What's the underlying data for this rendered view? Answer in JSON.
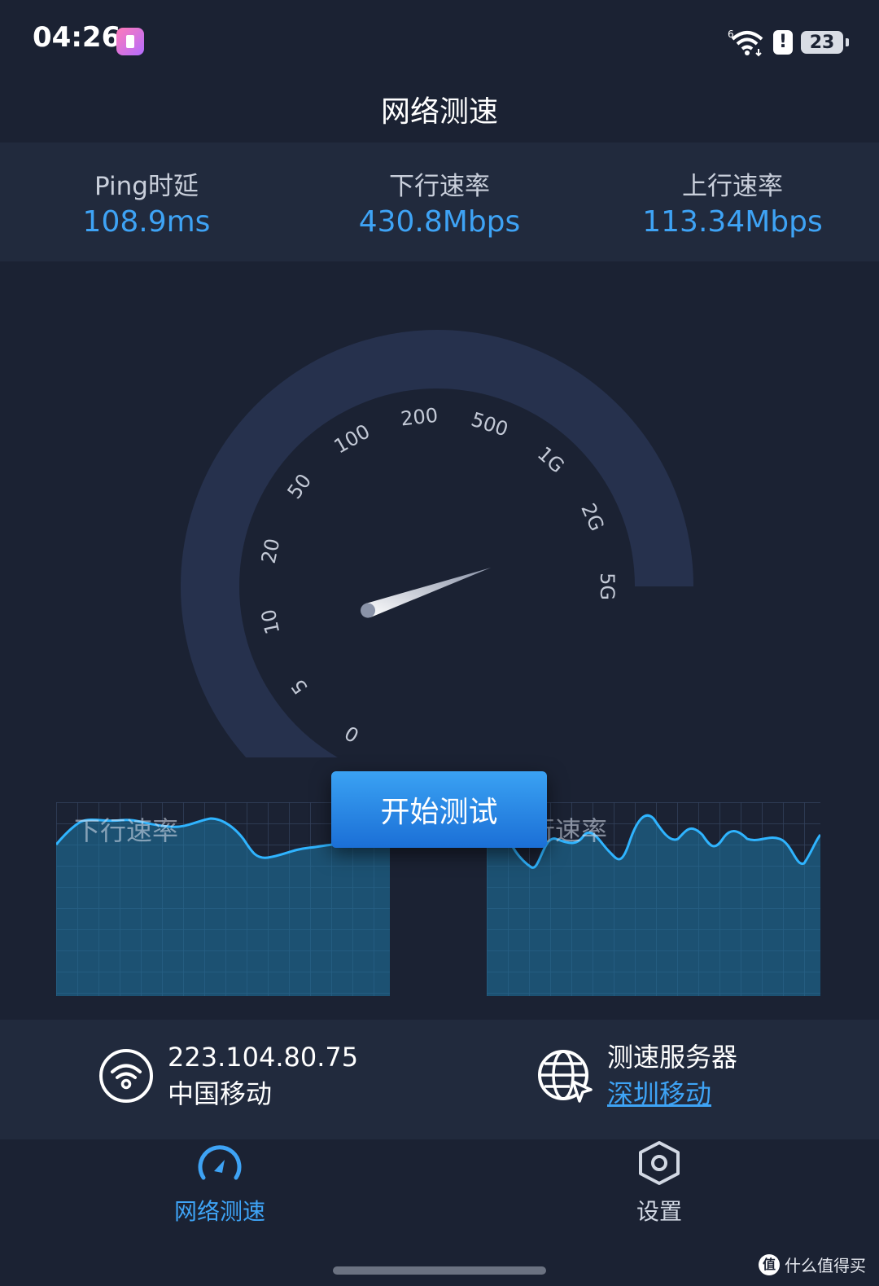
{
  "status_bar": {
    "time": "04:26",
    "battery_level": "23",
    "alert_glyph": "!",
    "wifi_superscript": "6"
  },
  "page_title": "网络测速",
  "stats": [
    {
      "label": "Ping时延",
      "value": "108.9ms"
    },
    {
      "label": "下行速率",
      "value": "430.8Mbps"
    },
    {
      "label": "上行速率",
      "value": "113.34Mbps"
    }
  ],
  "gauge": {
    "ticks": [
      "0",
      "5",
      "10",
      "20",
      "50",
      "100",
      "200",
      "500",
      "1G",
      "2G",
      "5G"
    ],
    "needle_fraction": 0.17
  },
  "start_button": {
    "label": "开始测试"
  },
  "charts": {
    "download_label": "下行速率",
    "upload_label": "上行速率"
  },
  "network": {
    "ip": "223.104.80.75",
    "carrier": "中国移动"
  },
  "server": {
    "label": "测速服务器",
    "name": "深圳移动"
  },
  "nav": {
    "speedtest": "网络测速",
    "settings": "设置"
  },
  "watermark": {
    "text": "什么值得买",
    "icon_glyph": "值"
  },
  "colors": {
    "background": "#1b2233",
    "panel": "#212a3d",
    "accent": "#3ea3f5",
    "gauge_track": "#26314d"
  }
}
